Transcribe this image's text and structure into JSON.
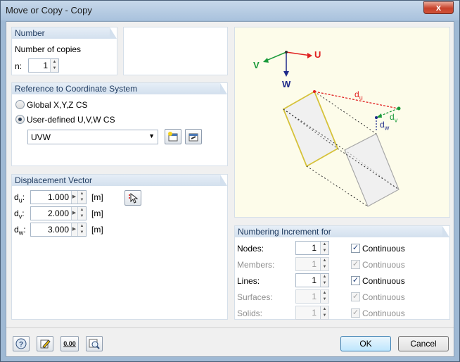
{
  "window": {
    "title": "Move or Copy - Copy",
    "close_symbol": "x"
  },
  "number_group": {
    "header": "Number",
    "copies_label": "Number of copies",
    "n_label": "n:",
    "n_value": "1"
  },
  "reference_group": {
    "header": "Reference to Coordinate System",
    "option_global": "Global X,Y,Z CS",
    "option_user": "User-defined U,V,W CS",
    "selected_option": "User-defined U,V,W CS",
    "cs_value": "UVW"
  },
  "displacement_group": {
    "header": "Displacement Vector",
    "rows": [
      {
        "label": "du:",
        "sub": "u",
        "value": "1.000",
        "unit": "[m]"
      },
      {
        "label": "dv:",
        "sub": "v",
        "value": "2.000",
        "unit": "[m]"
      },
      {
        "label": "dw:",
        "sub": "w",
        "value": "3.000",
        "unit": "[m]"
      }
    ]
  },
  "diagram": {
    "axis_u": "U",
    "axis_v": "V",
    "axis_w": "W",
    "label_du": "du",
    "label_dv": "dv",
    "label_dw": "dw",
    "colors": {
      "u_axis": "#e02020",
      "v_axis": "#1a9a3a",
      "w_axis": "#1f2a8a",
      "background": "#fdfcea"
    }
  },
  "numbering_group": {
    "header": "Numbering Increment for",
    "rows": [
      {
        "label": "Nodes:",
        "value": "1",
        "check_label": "Continuous",
        "enabled": true,
        "checked": true
      },
      {
        "label": "Members:",
        "value": "1",
        "check_label": "Continuous",
        "enabled": false,
        "checked": true
      },
      {
        "label": "Lines:",
        "value": "1",
        "check_label": "Continuous",
        "enabled": true,
        "checked": true
      },
      {
        "label": "Surfaces:",
        "value": "1",
        "check_label": "Continuous",
        "enabled": false,
        "checked": true
      },
      {
        "label": "Solids:",
        "value": "1",
        "check_label": "Continuous",
        "enabled": false,
        "checked": true
      }
    ]
  },
  "footer": {
    "ok_label": "OK",
    "cancel_label": "Cancel",
    "icons": [
      "help-icon",
      "edit-icon",
      "units-icon",
      "zoom-icon"
    ],
    "units_icon_text": "0.00"
  }
}
